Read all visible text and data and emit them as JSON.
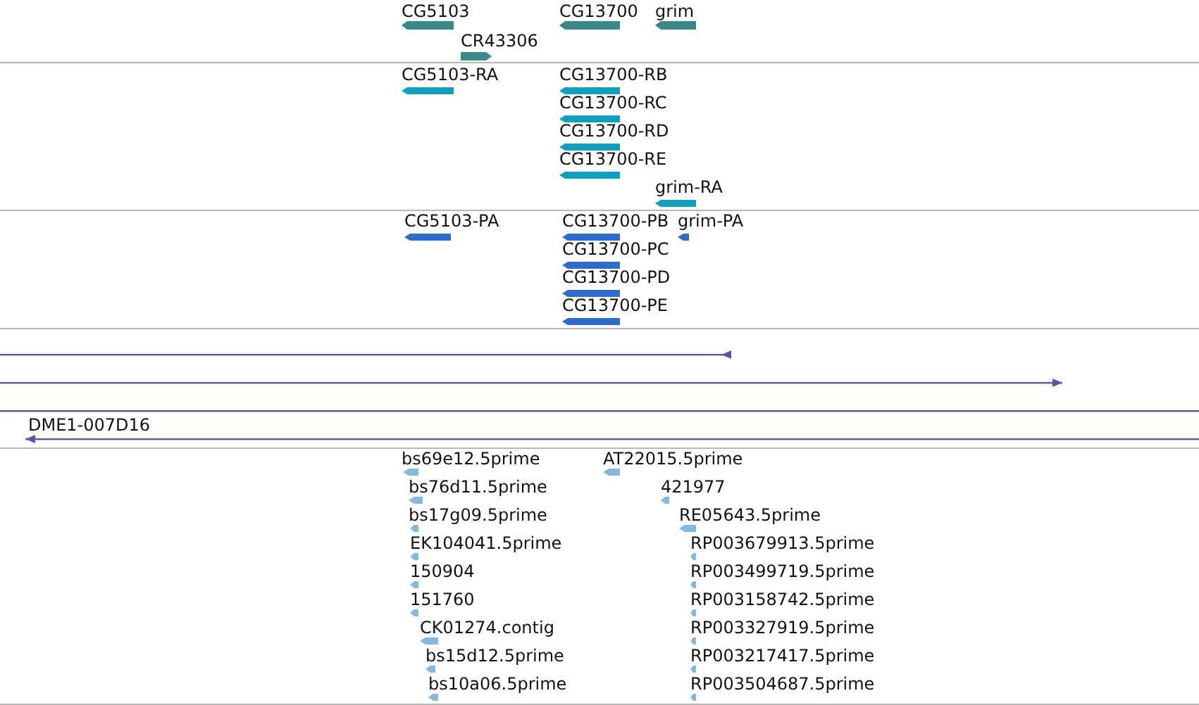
{
  "tracks": [
    {
      "kind": "gene",
      "color": "#3a8a8c",
      "features": [
        {
          "label": "CG5103",
          "reverse": true
        },
        {
          "label": "CR43306",
          "reverse": false
        },
        {
          "label": "CG13700",
          "reverse": true
        },
        {
          "label": "grim",
          "reverse": true
        }
      ]
    },
    {
      "kind": "transcript",
      "color": "#109fbf",
      "features": [
        {
          "label": "CG5103-RA",
          "reverse": true
        },
        {
          "label": "CG13700-RB",
          "reverse": true
        },
        {
          "label": "CG13700-RC",
          "reverse": true
        },
        {
          "label": "CG13700-RD",
          "reverse": true
        },
        {
          "label": "CG13700-RE",
          "reverse": true
        },
        {
          "label": "grim-RA",
          "reverse": true
        }
      ]
    },
    {
      "kind": "transcript",
      "color": "#2e6ccc",
      "features": [
        {
          "label": "CG5103-PA",
          "reverse": true
        },
        {
          "label": "CG13700-PB",
          "reverse": true
        },
        {
          "label": "grim-PA",
          "reverse": true
        },
        {
          "label": "CG13700-PC",
          "reverse": true
        },
        {
          "label": "CG13700-PD",
          "reverse": true
        },
        {
          "label": "CG13700-PE",
          "reverse": true
        }
      ]
    },
    {
      "kind": "alignment",
      "color": "#6a4fa8",
      "features": [
        {
          "arrow": true,
          "reverse": true
        },
        {
          "arrow": true,
          "reverse": false
        },
        {
          "arrow": false
        },
        {
          "label": "DME1-007D16",
          "arrow": true,
          "reverse": true
        }
      ]
    },
    {
      "kind": "est",
      "color": "#84b9df",
      "features": [
        {
          "label": "bs69e12.5prime",
          "reverse": true
        },
        {
          "label": "AT22015.5prime",
          "reverse": true
        },
        {
          "label": "bs76d11.5prime",
          "reverse": true
        },
        {
          "label": "421977",
          "reverse": true
        },
        {
          "label": "bs17g09.5prime",
          "reverse": true
        },
        {
          "label": "RE05643.5prime",
          "reverse": true
        },
        {
          "label": "EK104041.5prime",
          "reverse": true
        },
        {
          "label": "RP003679913.5prime",
          "reverse": true
        },
        {
          "label": "150904",
          "reverse": true
        },
        {
          "label": "RP003499719.5prime",
          "reverse": true
        },
        {
          "label": "151760",
          "reverse": true
        },
        {
          "label": "RP003158742.5prime",
          "reverse": true
        },
        {
          "label": "CK01274.contig",
          "reverse": true
        },
        {
          "label": "RP003327919.5prime",
          "reverse": true
        },
        {
          "label": "bs15d12.5prime",
          "reverse": true
        },
        {
          "label": "RP003217417.5prime",
          "reverse": true
        },
        {
          "label": "bs10a06.5prime",
          "reverse": true
        },
        {
          "label": "RP003504687.5prime",
          "reverse": true
        }
      ]
    }
  ]
}
